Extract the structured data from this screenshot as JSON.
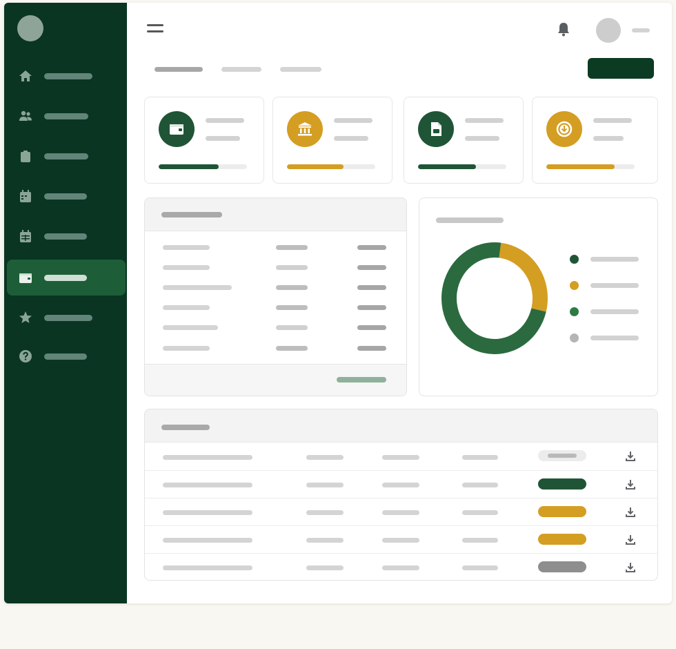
{
  "colors": {
    "sidebar_bg": "#0a3522",
    "brand_green": "#1f5536",
    "accent_gold": "#d49e23",
    "neutral_gray": "#8e8e8e"
  },
  "sidebar": {
    "items": [
      {
        "icon": "home-icon"
      },
      {
        "icon": "users-icon"
      },
      {
        "icon": "clipboard-icon"
      },
      {
        "icon": "calendar-icon"
      },
      {
        "icon": "calendar-grid-icon"
      },
      {
        "icon": "wallet-icon",
        "active": true
      },
      {
        "icon": "star-icon"
      },
      {
        "icon": "help-icon"
      }
    ]
  },
  "header": {
    "icons": [
      "menu-icon",
      "bell-icon",
      "user-avatar"
    ]
  },
  "stat_cards": [
    {
      "icon": "wallet-icon",
      "color": "#1f5536",
      "progress": 0.68
    },
    {
      "icon": "bank-icon",
      "color": "#d49e23",
      "progress": 0.64
    },
    {
      "icon": "document-icon",
      "color": "#1f5536",
      "progress": 0.66
    },
    {
      "icon": "download-circle-icon",
      "color": "#d49e23",
      "progress": 0.77
    }
  ],
  "donut_chart": {
    "segments": [
      {
        "fraction": 0.27,
        "color": "#d49e23"
      },
      {
        "fraction": 0.73,
        "color": "#2b6a3f"
      }
    ],
    "legend_dots": [
      "#1f5536",
      "#d49e23",
      "#2e7a45",
      "#b5b5b5"
    ]
  },
  "transactions": {
    "row_statuses": [
      {
        "status": "neutral",
        "color": "#ececec"
      },
      {
        "status": "green",
        "color": "#1f5536"
      },
      {
        "status": "gold",
        "color": "#d49e23"
      },
      {
        "status": "gold",
        "color": "#d49e23"
      },
      {
        "status": "gray",
        "color": "#8e8e8e"
      }
    ]
  }
}
